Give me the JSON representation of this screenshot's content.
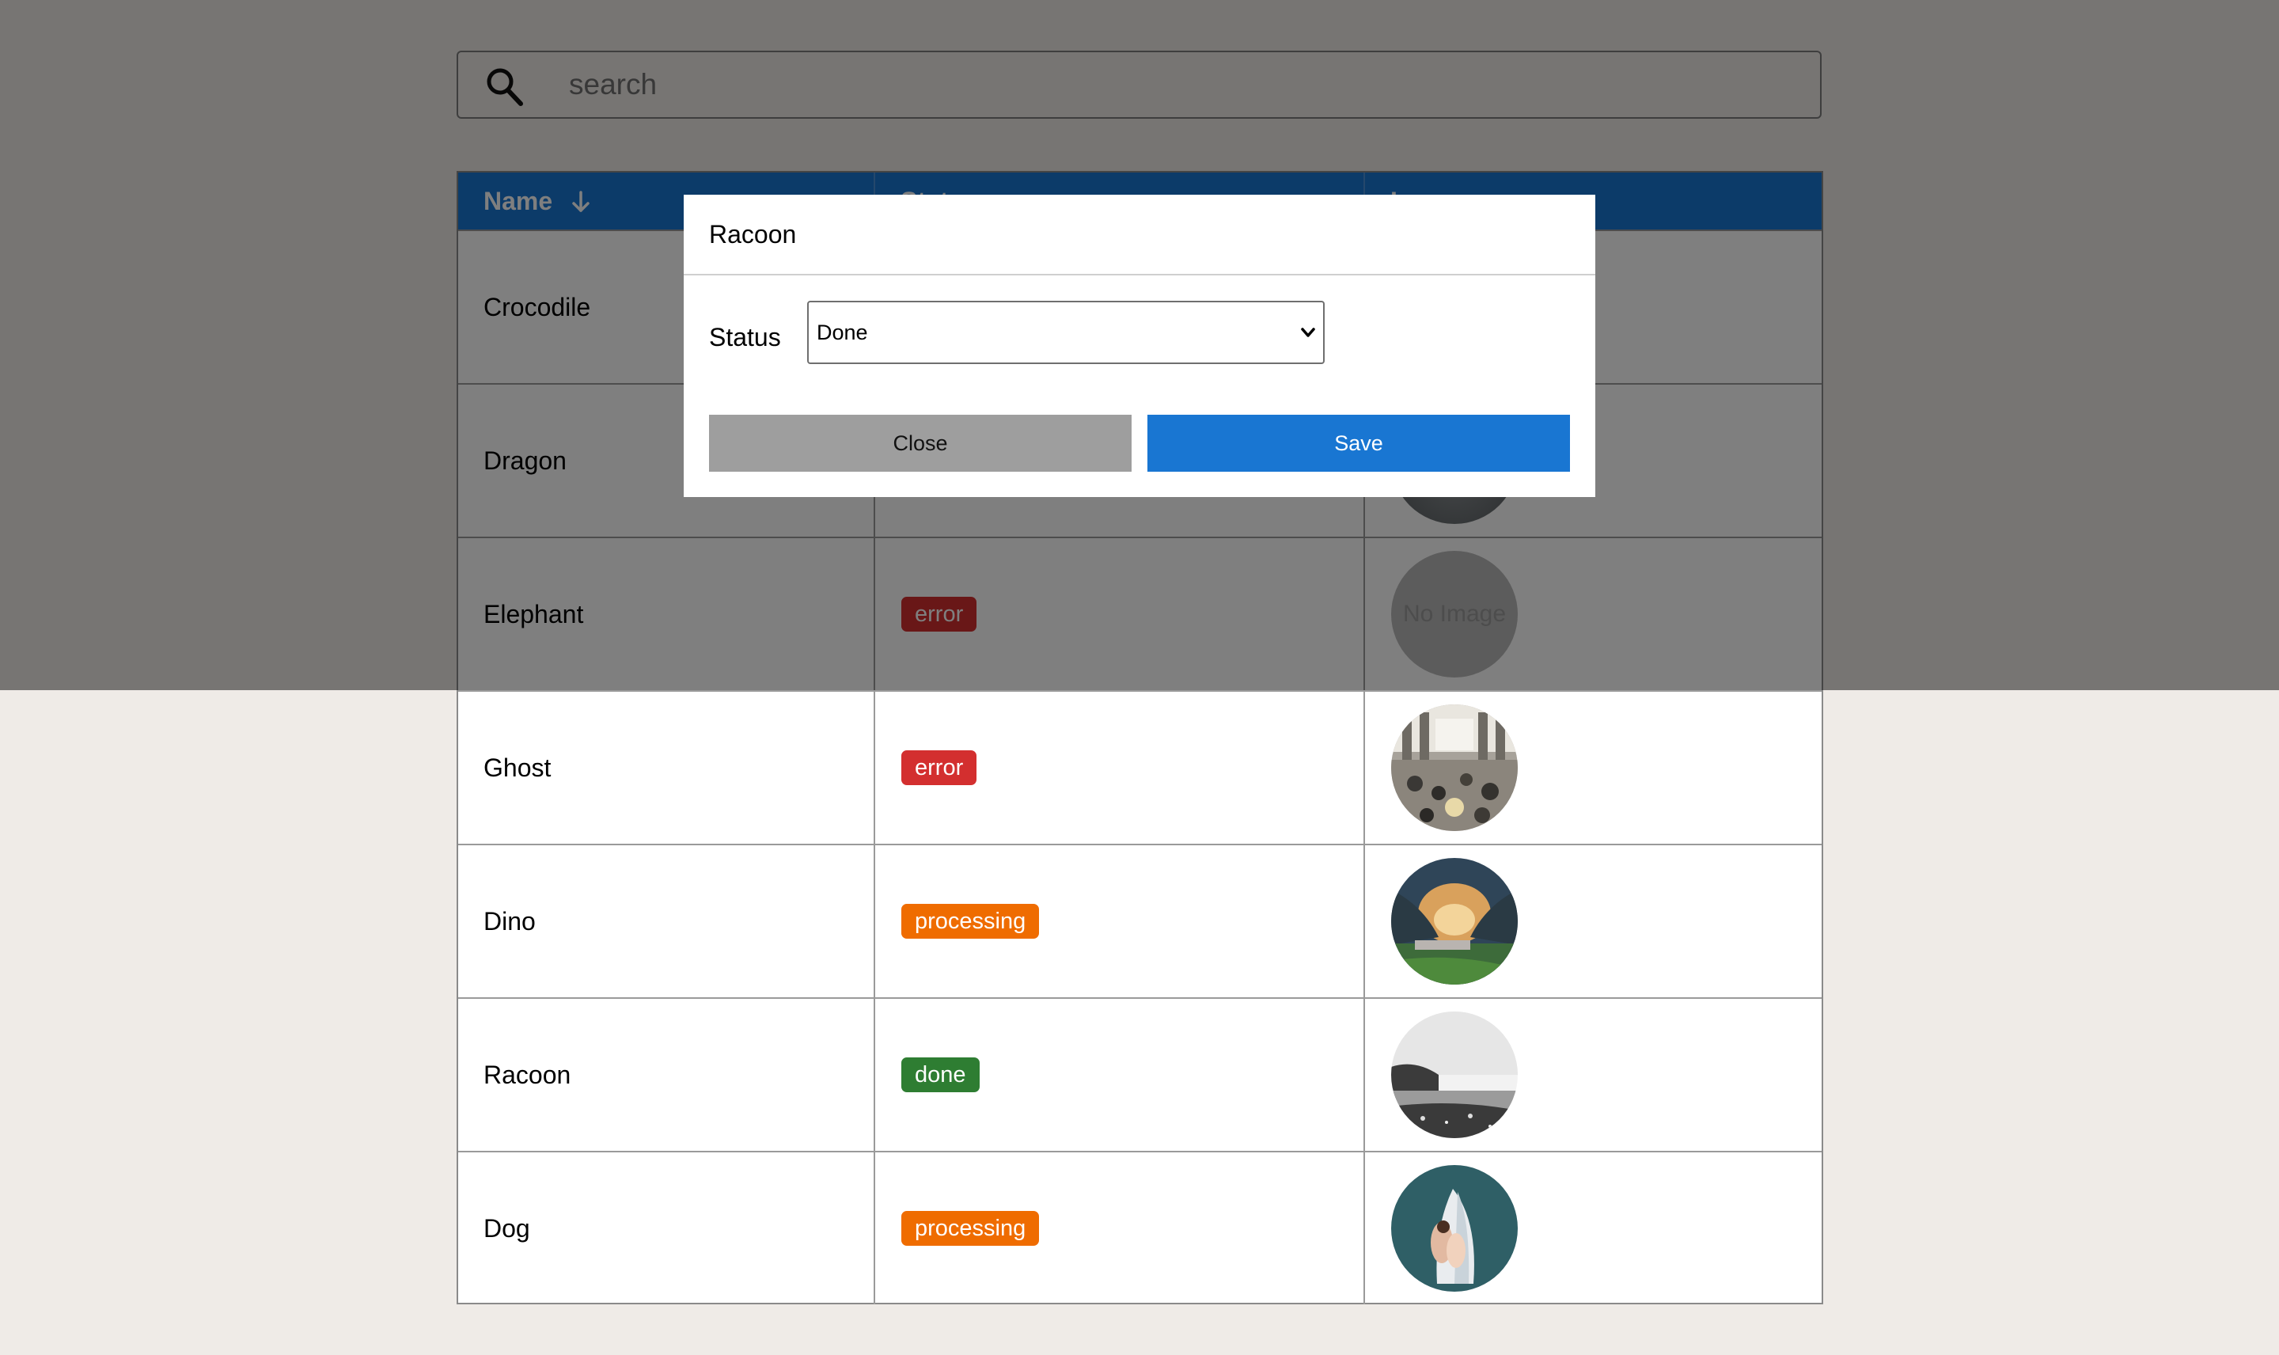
{
  "search": {
    "placeholder": "search",
    "value": ""
  },
  "table": {
    "headers": [
      "Name",
      "Status",
      "Image"
    ],
    "sort_icon": "arrow-down-icon",
    "rows": [
      {
        "name": "Crocodile",
        "status": "",
        "image": "photo"
      },
      {
        "name": "Dragon",
        "status": "",
        "image": "photo-gray-texture"
      },
      {
        "name": "Elephant",
        "status": "error",
        "image": "No Image"
      },
      {
        "name": "Ghost",
        "status": "error",
        "image": "photo-building-interior"
      },
      {
        "name": "Dino",
        "status": "processing",
        "image": "photo-trees-sunset"
      },
      {
        "name": "Racoon",
        "status": "done",
        "image": "photo-foggy-lake"
      },
      {
        "name": "Dog",
        "status": "processing",
        "image": "photo-couple-veil"
      }
    ],
    "no_image_label": "No Image"
  },
  "status_colors": {
    "error": "#d32f2f",
    "processing": "#ef6c00",
    "done": "#2e7d32"
  },
  "modal": {
    "title": "Racoon",
    "status_label": "Status",
    "status_value": "Done",
    "close_label": "Close",
    "save_label": "Save"
  },
  "colors": {
    "header": "#1976d2",
    "save": "#1976d2",
    "close": "#9e9e9e",
    "background": "#efebe7"
  }
}
